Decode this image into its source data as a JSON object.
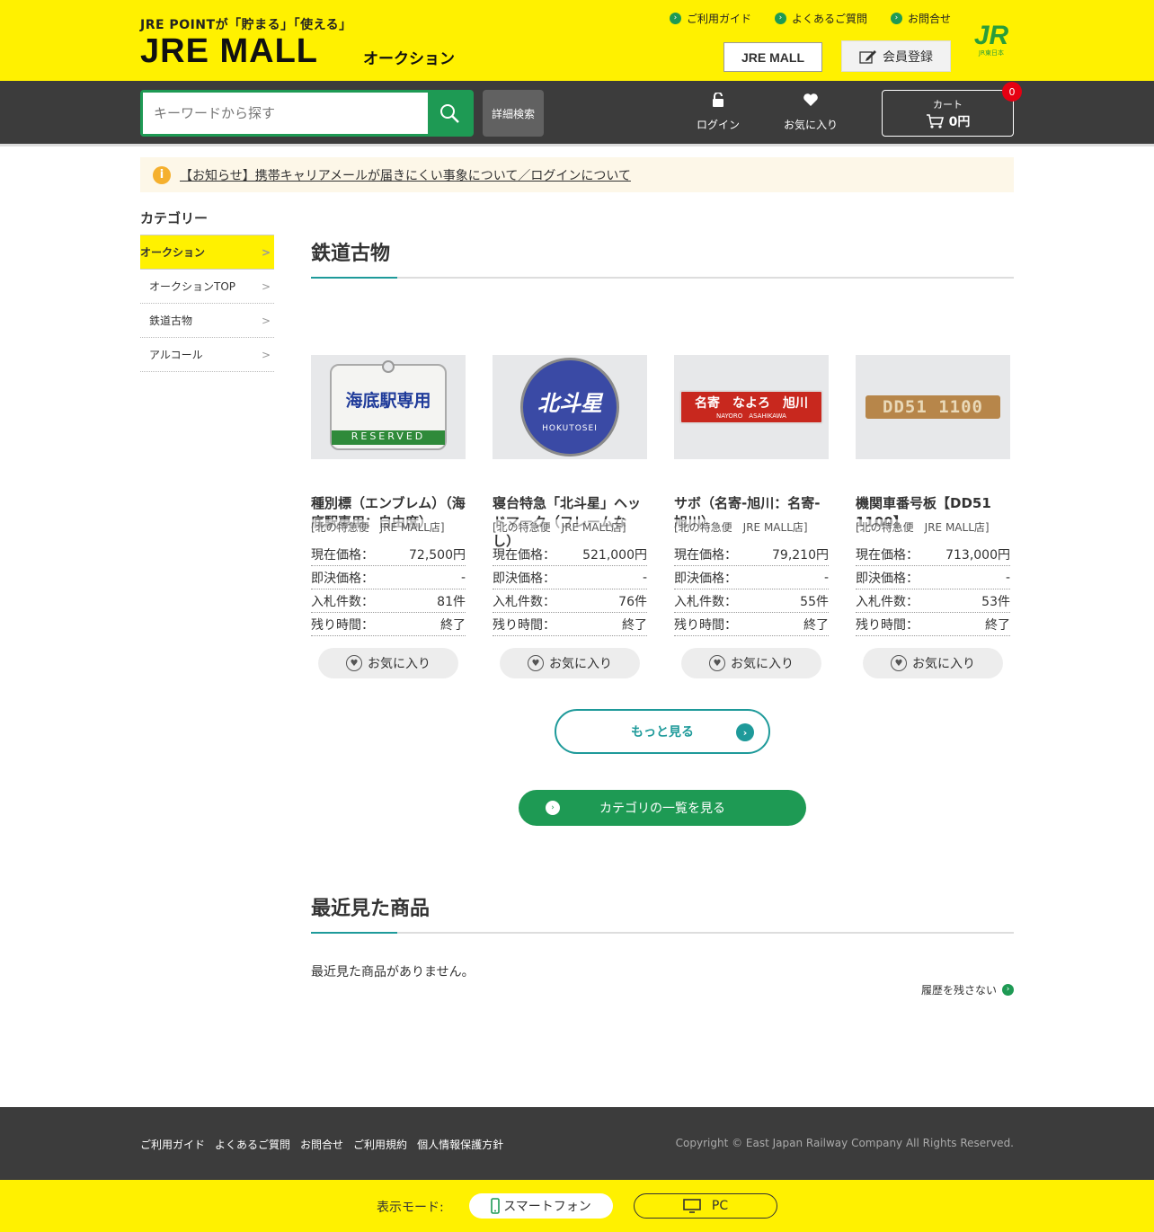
{
  "header": {
    "tagline": "JRE POINTが「貯まる」「使える」",
    "logo": "JRE MALL",
    "logo_sub": "オークション",
    "links": [
      "ご利用ガイド",
      "よくあるご質問",
      "お問合せ"
    ],
    "mall_button": "JRE MALL",
    "register_button": "会員登録",
    "jr_logo": "JR",
    "jr_sub": "JR東日本"
  },
  "nav": {
    "search_placeholder": "キーワードから探す",
    "advanced_search": "詳細検索",
    "login": "ログイン",
    "favorites": "お気に入り",
    "cart_label": "カート",
    "cart_amount": "0円",
    "cart_count": "0"
  },
  "notice": {
    "text": "【お知らせ】携帯キャリアメールが届きにくい事象について／ログインについて"
  },
  "sidebar": {
    "title": "カテゴリー",
    "items": [
      {
        "label": "オークション"
      },
      {
        "label": "オークションTOP"
      },
      {
        "label": "鉄道古物"
      },
      {
        "label": "アルコール"
      }
    ]
  },
  "section": {
    "title": "鉄道古物"
  },
  "labels": {
    "current_price": "現在価格：",
    "buyout_price": "即決価格：",
    "bids": "入札件数：",
    "remaining": "残り時間：",
    "favorite": "お気に入り"
  },
  "products": [
    {
      "name": "種別標（エンブレム）（海底駅専用：自由席）",
      "shop": "[北の特急便　JRE MALL店]",
      "current": "72,500円",
      "buyout": "-",
      "bids": "81件",
      "remaining": "終了",
      "image_text": "海底駅専用",
      "image_sub": "RESERVED"
    },
    {
      "name": "寝台特急「北斗星」ヘッドマーク（フレームなし）",
      "shop": "[北の特急便　JRE MALL店]",
      "current": "521,000円",
      "buyout": "-",
      "bids": "76件",
      "remaining": "終了",
      "image_text": "北斗星",
      "image_sub": "HOKUTOSEI"
    },
    {
      "name": "サボ（名寄-旭川：名寄-旭川）",
      "shop": "[北の特急便　JRE MALL店]",
      "current": "79,210円",
      "buyout": "-",
      "bids": "55件",
      "remaining": "終了",
      "image_text": "名寄　なよろ　旭川",
      "image_sub": "NAYORO　ASAHIKAWA"
    },
    {
      "name": "機関車番号板【DD51 1100】",
      "shop": "[北の特急便　JRE MALL店]",
      "current": "713,000円",
      "buyout": "-",
      "bids": "53件",
      "remaining": "終了",
      "image_text": "DD51 1100",
      "image_sub": ""
    }
  ],
  "buttons": {
    "more": "もっと見る",
    "category_list": "カテゴリの一覧を見る"
  },
  "recent": {
    "title": "最近見た商品",
    "empty": "最近見た商品がありません。",
    "no_history": "履歴を残さない"
  },
  "footer": {
    "links": [
      "ご利用ガイド",
      "よくあるご質問",
      "お問合せ",
      "ご利用規約",
      "個人情報保護方針"
    ],
    "copyright": "Copyright © East Japan Railway Company All Rights Reserved."
  },
  "mode": {
    "label": "表示モード:",
    "smartphone": "スマートフォン",
    "pc": "PC"
  },
  "colors": {
    "yellow": "#fff100",
    "green": "#1e9a54",
    "teal": "#1e9a9a",
    "dark": "#3c3c3c"
  }
}
